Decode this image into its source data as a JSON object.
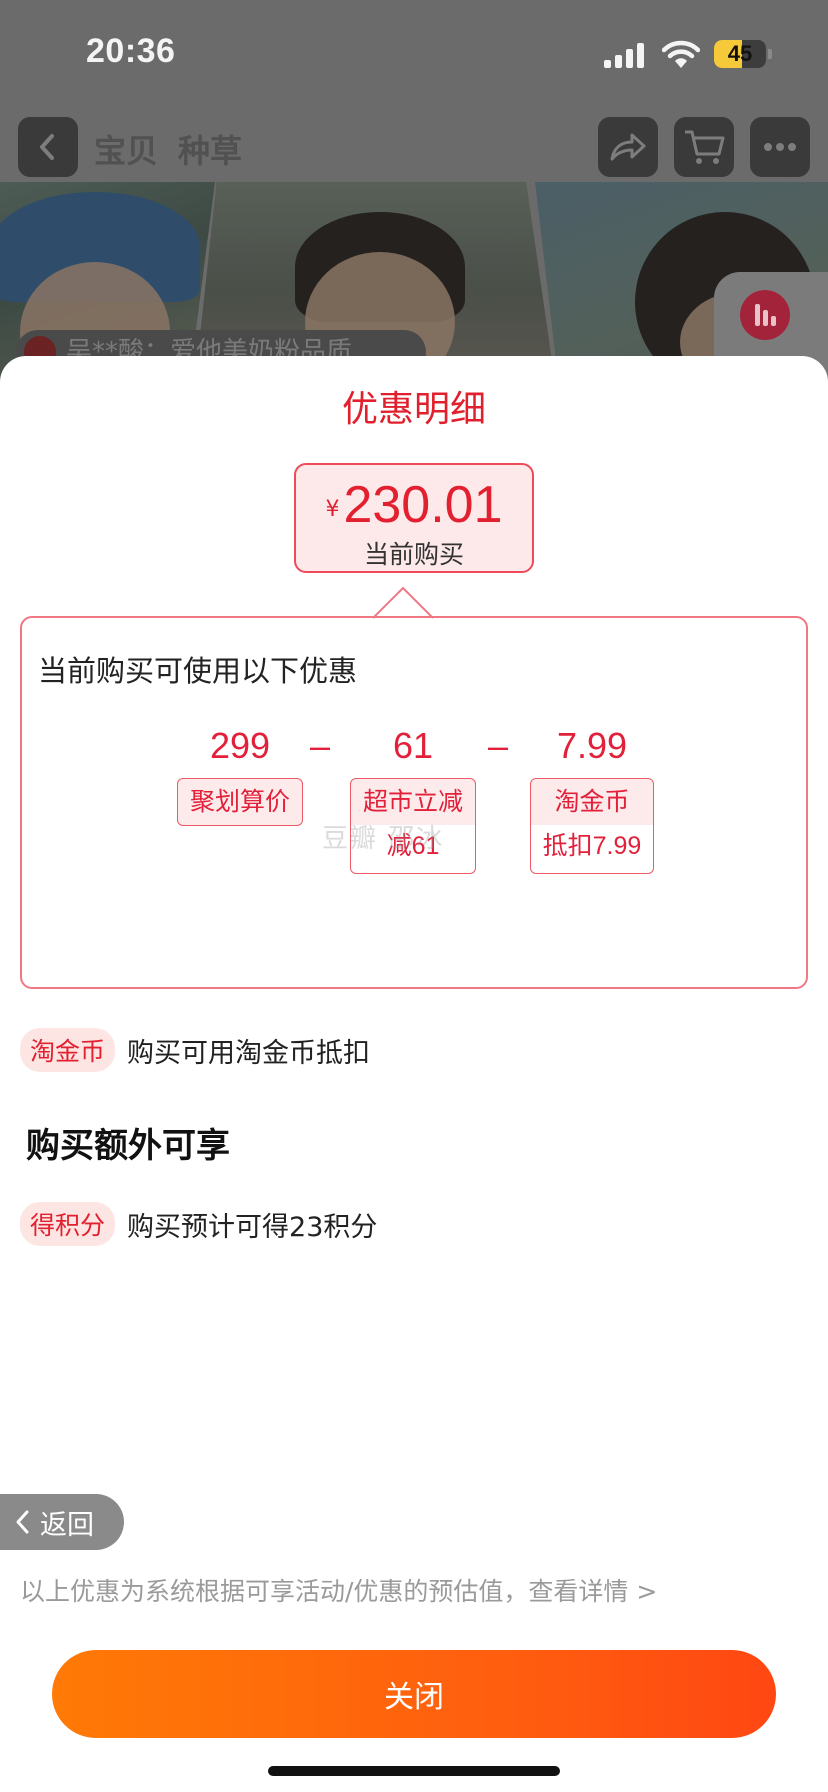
{
  "status_bar": {
    "time": "20:36",
    "battery": "45"
  },
  "product_page": {
    "nav_tabs": [
      "宝贝",
      "种草"
    ],
    "promo_strip_text": "吴**酸：爱他美奶粉品质"
  },
  "sheet": {
    "title": "优惠明细",
    "price": {
      "currency": "¥",
      "amount": "230.01",
      "label": "当前购买"
    },
    "detail": {
      "heading": "当前购买可使用以下优惠",
      "items": [
        {
          "value": "299",
          "tag": "聚划算价",
          "sub": ""
        },
        {
          "value": "61",
          "tag": "超市立减",
          "sub": "减61"
        },
        {
          "value": "7.99",
          "tag": "淘金币",
          "sub": "抵扣7.99"
        }
      ],
      "operator": "–",
      "watermark": "豆瓣 邵冰"
    },
    "coin_row": {
      "badge": "淘金币",
      "text": "购买可用淘金币抵扣"
    },
    "extra_section_title": "购买额外可享",
    "points_row": {
      "badge": "得积分",
      "text": "购买预计可得23积分"
    },
    "back_label": "返回",
    "footnote": "以上优惠为系统根据可享活动/优惠的预估值，查看详情 >",
    "close_label": "关闭"
  },
  "colors": {
    "accent_red": "#e3202f",
    "button_orange": "#ff6a0a"
  }
}
